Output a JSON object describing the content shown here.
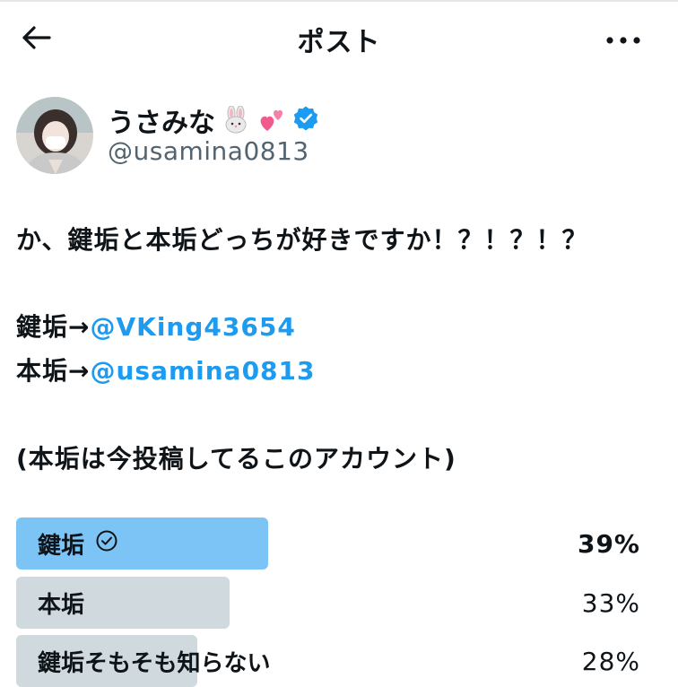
{
  "header": {
    "title": "ポスト",
    "back_icon": "arrow-left-icon",
    "more_icon": "more-horizontal-icon"
  },
  "author": {
    "name": "うさみな",
    "name_emojis": [
      "rabbit-face-emoji",
      "two-hearts-emoji"
    ],
    "verified_color": "#1d9bf0",
    "handle": "@usamina0813"
  },
  "post": {
    "line1": "か、鍵垢と本垢どっちが好きですか！？！？！？",
    "line2_prefix": "鍵垢→",
    "line2_mention": "@VKing43654",
    "line3_prefix": "本垢→",
    "line3_mention": "@usamina0813",
    "line4": "(本垢は今投稿してるこのアカウント)"
  },
  "poll": {
    "options": [
      {
        "label": "鍵垢",
        "percent_text": "39%",
        "percent": 39,
        "selected": true
      },
      {
        "label": "本垢",
        "percent_text": "33%",
        "percent": 33,
        "selected": false
      },
      {
        "label": "鍵垢そもそも知らない",
        "percent_text": "28%",
        "percent": 28,
        "selected": false
      }
    ],
    "winner_color": "#7cc4f5",
    "other_color": "#cfd9de",
    "check_icon": "check-circle-icon"
  }
}
